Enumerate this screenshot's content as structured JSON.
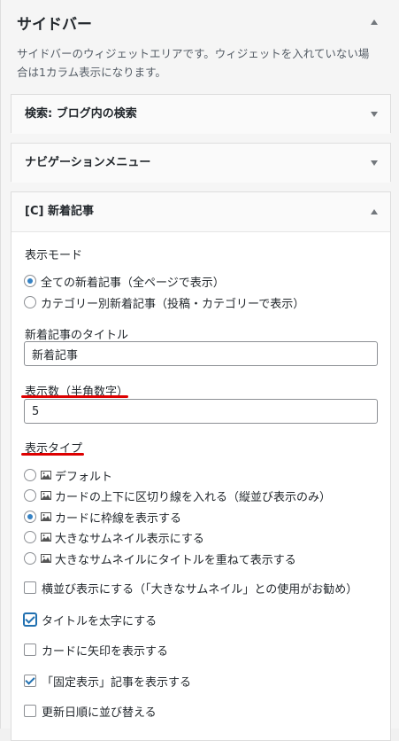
{
  "sidebar": {
    "title": "サイドバー",
    "description_line1": "サイドバーのウィジェットエリアです。ウィジェットを入れていない場",
    "description_line2": "合は1カラム表示になります。"
  },
  "widgets": [
    {
      "title": "検索: ブログ内の検索",
      "state": "collapsed"
    },
    {
      "title": "ナビゲーションメニュー",
      "state": "collapsed"
    },
    {
      "title": "[C] 新着記事",
      "state": "expanded"
    }
  ],
  "form": {
    "mode_label": "表示モード",
    "mode_options": [
      {
        "label": "全ての新着記事（全ページで表示）",
        "checked": true
      },
      {
        "label": "カテゴリー別新着記事（投稿・カテゴリーで表示）",
        "checked": false
      }
    ],
    "title_label": "新着記事のタイトル",
    "title_value": "新着記事",
    "count_label": "表示数（半角数字）",
    "count_value": "5",
    "type_label": "表示タイプ",
    "type_options": [
      {
        "label": "デフォルト",
        "checked": false
      },
      {
        "label": "カードの上下に区切り線を入れる（縦並び表示のみ）",
        "checked": false
      },
      {
        "label": "カードに枠線を表示する",
        "checked": true
      },
      {
        "label": "大きなサムネイル表示にする",
        "checked": false
      },
      {
        "label": "大きなサムネイルにタイトルを重ねて表示する",
        "checked": false
      }
    ],
    "checkboxes": [
      {
        "label": "横並び表示にする（「大きなサムネイル」との使用がお勧め）",
        "checked": false
      },
      {
        "label": "タイトルを太字にする",
        "checked": true
      },
      {
        "label": "カードに矢印を表示する",
        "checked": false
      },
      {
        "label": "「固定表示」記事を表示する",
        "checked": true
      },
      {
        "label": "更新日順に並び替える",
        "checked": false
      }
    ]
  },
  "colors": {
    "accent": "#2271b1",
    "annotation_underline": "#dd0000"
  },
  "icons": {
    "image": "image-icon",
    "collapse": "triangle-up-icon",
    "expand": "triangle-down-icon"
  }
}
